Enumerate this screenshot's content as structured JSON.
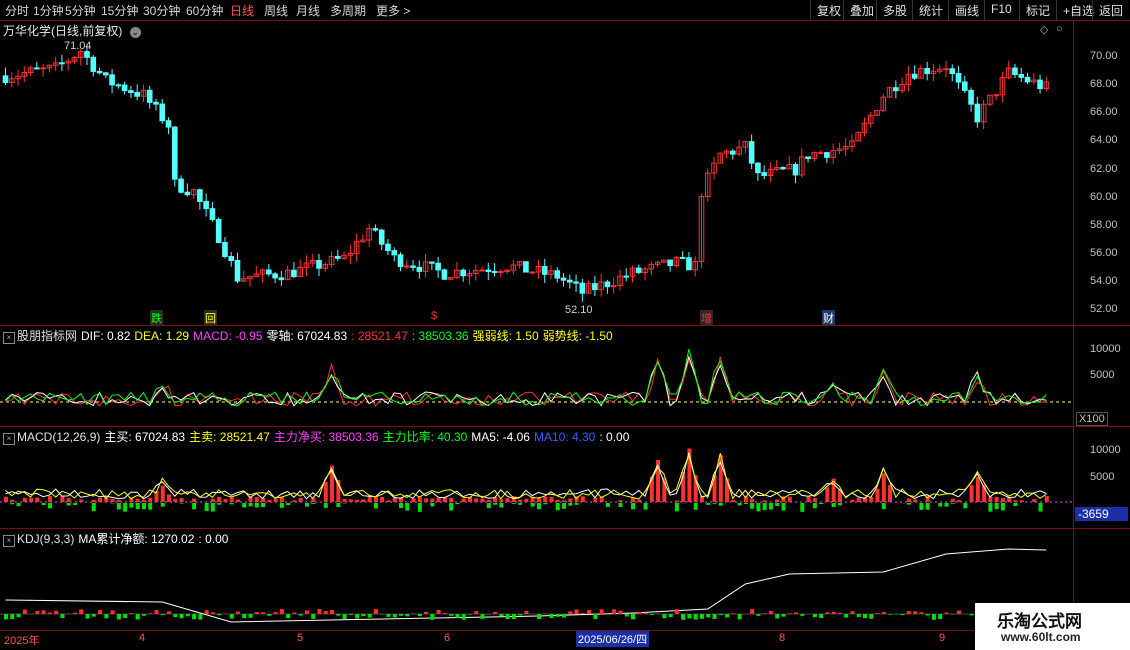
{
  "toolbar": {
    "periods": [
      "分时",
      "1分钟",
      "5分钟",
      "15分钟",
      "30分钟",
      "60分钟",
      "日线",
      "周线",
      "月线",
      "多周期",
      "更多 >"
    ],
    "active": "日线",
    "right": [
      "复权",
      "叠加",
      "多股",
      "统计",
      "画线",
      "F10",
      "+自选",
      "返回"
    ],
    "extra": "标记"
  },
  "main": {
    "title": "万华化学(日线,前复权)",
    "high_label": "71.04",
    "low_label": "52.10",
    "y_ticks": [
      "70.00",
      "68.00",
      "66.00",
      "64.00",
      "62.00",
      "60.00",
      "58.00",
      "56.00",
      "54.00",
      "52.00"
    ],
    "markers": [
      {
        "text": "跌",
        "color": "#00ff00"
      },
      {
        "text": "回",
        "color": "#ffff00"
      },
      {
        "text": "$",
        "color": "#ff3030"
      },
      {
        "text": "增",
        "color": "#ff3030"
      },
      {
        "text": "财",
        "color": "#ffffff"
      }
    ]
  },
  "ind1": {
    "name": "股朋指标网",
    "dif": "DIF: 0.82",
    "dea": "DEA: 1.29",
    "macd": "MACD: -0.95",
    "zero": "零轴: 67024.83",
    "v1": ": 28521.47",
    "v2": ": 38503.36",
    "strong": "强弱线: 1.50",
    "weak": "弱势线: -1.50",
    "y_ticks": [
      "10000",
      "5000"
    ],
    "scale": "X100"
  },
  "ind2": {
    "name": "MACD(12,26,9)",
    "buy": "主买: 67024.83",
    "sell": "主卖: 28521.47",
    "net": "主力净买: 38503.36",
    "ratio": "主力比率: 40.30",
    "ma5": "MA5: -4.06",
    "ma10": "MA10: 4.30",
    "tail": ": 0.00",
    "y_ticks": [
      "10000",
      "5000"
    ],
    "badge": "-3659"
  },
  "ind3": {
    "name": "KDJ(9,3,3)",
    "ma": "MA累计净额: 1270.02",
    "tail": ": 0.00"
  },
  "xaxis": {
    "labels": [
      "2025年",
      "4",
      "5",
      "6",
      "7",
      "8",
      "9"
    ],
    "cursor_date": "2025/06/26/四"
  },
  "watermark": {
    "title": "乐淘公式网",
    "url": "www.60lt.com"
  },
  "colors": {
    "up": "#ff3030",
    "down": "#54ffff",
    "grid": "#7a0f0f"
  }
}
